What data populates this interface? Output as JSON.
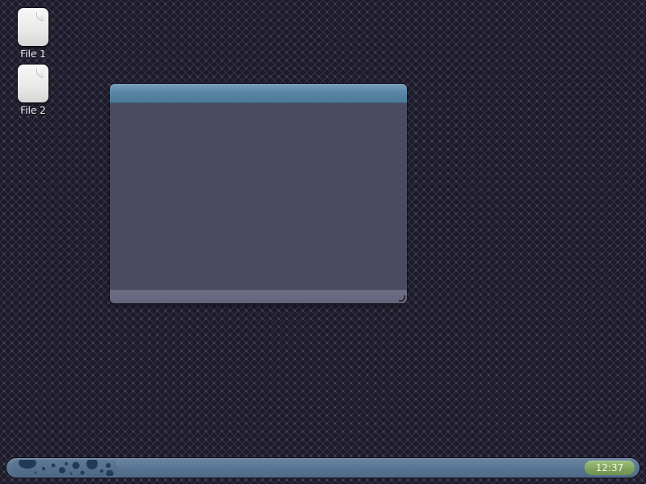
{
  "desktop": {
    "icons": [
      {
        "label": "File 1",
        "icon": "file-icon"
      },
      {
        "label": "File 2",
        "icon": "file-icon"
      }
    ]
  },
  "window": {
    "title": ""
  },
  "taskbar": {
    "start_icon": "bubbles-logo-icon",
    "clock": "12:37"
  },
  "colors": {
    "desktop_background": "#1f1c2a",
    "window_titlebar": "#5a86a6",
    "window_body": "#4a4a60",
    "taskbar": "#587492",
    "clock_accent": "#7ea05a"
  }
}
